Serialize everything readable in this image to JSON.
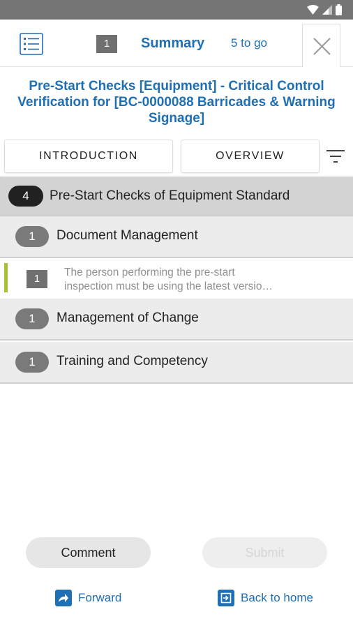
{
  "header": {
    "remaining_count": "1",
    "summary_label": "Summary",
    "to_go_label": "5 to go"
  },
  "page": {
    "title": "Pre-Start Checks [Equipment] - Critical Control Verification for [BC-0000088 Barricades & Warning Signage]"
  },
  "tabs": [
    {
      "label": "INTRODUCTION"
    },
    {
      "label": "OVERVIEW"
    }
  ],
  "section": {
    "count": "4",
    "label": "Pre-Start Checks of Equipment Standard"
  },
  "subsections": [
    {
      "count": "1",
      "label": "Document Management",
      "items": [
        {
          "number": "1",
          "line1": "The person performing the pre-start",
          "line2": "inspection must be using the latest versio…"
        }
      ]
    },
    {
      "count": "1",
      "label": "Management of Change"
    },
    {
      "count": "1",
      "label": "Training and Competency"
    }
  ],
  "footer": {
    "comment_label": "Comment",
    "submit_label": "Submit",
    "forward_label": "Forward",
    "back_home_label": "Back to home"
  },
  "icons": {
    "menu": "list-icon",
    "close": "close-icon",
    "filter": "filter-icon",
    "forward": "forward-icon",
    "home": "exit-icon"
  },
  "colors": {
    "accent": "#1f6fb5",
    "status_bar": "#757575",
    "item_marker": "#a8c236"
  }
}
